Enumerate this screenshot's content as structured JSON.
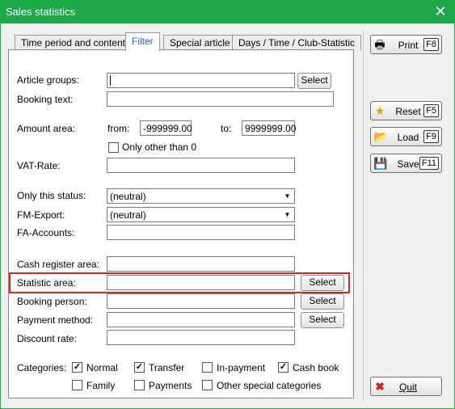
{
  "window": {
    "title": "Sales statistics",
    "close_glyph": "✕"
  },
  "tabs": [
    {
      "label": "Time period and content"
    },
    {
      "label": "Filter"
    },
    {
      "label": "Special article"
    },
    {
      "label": "Days / Time / Club-Statistic"
    }
  ],
  "form": {
    "article_groups": {
      "label": "Article groups:",
      "value": "",
      "button": "Select"
    },
    "booking_text": {
      "label": "Booking text:",
      "value": ""
    },
    "amount_area": {
      "label": "Amount area:",
      "from_label": "from:",
      "from_value": "-999999.00",
      "to_label": "to:",
      "to_value": "9999999.00"
    },
    "only_other_than_zero": {
      "label": "Only other than 0",
      "checked": false
    },
    "vat_rate": {
      "label": "VAT-Rate:",
      "value": ""
    },
    "only_this_status": {
      "label": "Only this status:",
      "value": "(neutral)"
    },
    "fm_export": {
      "label": "FM-Export:",
      "value": "(neutral)"
    },
    "fa_accounts": {
      "label": "FA-Accounts:",
      "value": ""
    },
    "cash_register_area": {
      "label": "Cash register area:",
      "value": ""
    },
    "statistic_area": {
      "label": "Statistic area:",
      "value": "",
      "button": "Select"
    },
    "booking_person": {
      "label": "Booking person:",
      "value": "",
      "button": "Select"
    },
    "payment_method": {
      "label": "Payment method:",
      "value": "",
      "button": "Select"
    },
    "discount_rate": {
      "label": "Discount rate:",
      "value": ""
    }
  },
  "categories": {
    "label": "Categories:",
    "items": [
      {
        "label": "Normal",
        "checked": true
      },
      {
        "label": "Transfer",
        "checked": true
      },
      {
        "label": "In-payment",
        "checked": false
      },
      {
        "label": "Cash book",
        "checked": true
      },
      {
        "label": "Family",
        "checked": false
      },
      {
        "label": "Payments",
        "checked": false
      },
      {
        "label": "Other special categories",
        "checked": false
      }
    ]
  },
  "side_buttons": {
    "print": {
      "label": "Print",
      "key": "F8",
      "icon": "printer-icon"
    },
    "reset": {
      "label": "Reset",
      "key": "F5",
      "icon": "star-icon"
    },
    "load": {
      "label": "Load",
      "key": "F9",
      "icon": "folder-icon"
    },
    "save": {
      "label": "Save",
      "key": "F11",
      "icon": "floppy-icon"
    },
    "quit": {
      "label": "Quit",
      "icon": "close-icon"
    }
  },
  "colors": {
    "titlebar": "#1ea84a",
    "highlight": "#e02424",
    "active_tab_text": "#2a5bd6"
  }
}
